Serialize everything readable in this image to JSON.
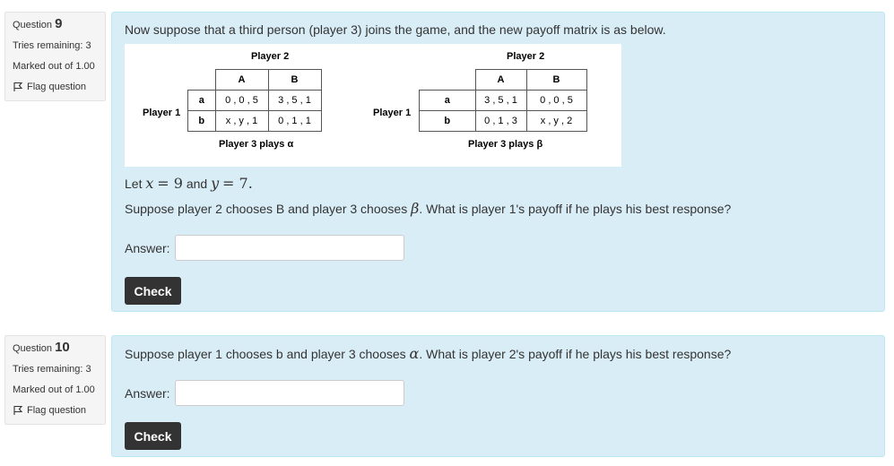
{
  "q9": {
    "info": {
      "question_word": "Question",
      "number": "9",
      "tries": "Tries remaining: 3",
      "marked": "Marked out of 1.00",
      "flag_label": "Flag question"
    },
    "text1": "Now suppose that a third person (player 3) joins the game, and the new payoff matrix is as below.",
    "matrix_alpha": {
      "col_player": "Player 2",
      "row_player": "Player 1",
      "cols": [
        "A",
        "B"
      ],
      "rows": [
        {
          "label": "a",
          "cells": [
            "0 , 0 , 5",
            "3 , 5 , 1"
          ]
        },
        {
          "label": "b",
          "cells": [
            "x , y , 1",
            "0 , 1 , 1"
          ]
        }
      ],
      "caption": "Player 3 plays α"
    },
    "matrix_beta": {
      "col_player": "Player 2",
      "row_player": "Player 1",
      "cols": [
        "A",
        "B"
      ],
      "rows": [
        {
          "label": "a",
          "cells": [
            "3 , 5 , 1",
            "0 , 0 , 5"
          ]
        },
        {
          "label": "b",
          "cells": [
            "0 , 1 , 3",
            "x , y , 2"
          ]
        }
      ],
      "caption": "Player 3 plays β"
    },
    "let_prefix": "Let",
    "let_x": "x",
    "let_eq1": "= 9",
    "let_and": "and",
    "let_y": "y",
    "let_eq2": "= 7.",
    "text3_a": "Suppose player 2 chooses B and player 3 chooses",
    "text3_sym": "β",
    "text3_b": ". What is player 1's payoff if he plays his best response?",
    "answer_label": "Answer:",
    "answer_value": "",
    "check_label": "Check"
  },
  "q10": {
    "info": {
      "question_word": "Question",
      "number": "10",
      "tries": "Tries remaining: 3",
      "marked": "Marked out of 1.00",
      "flag_label": "Flag question"
    },
    "text_a": "Suppose player 1 chooses b and player 3 chooses",
    "text_sym": "α",
    "text_b": ". What is player 2's payoff if he plays his best response?",
    "answer_label": "Answer:",
    "answer_value": "",
    "check_label": "Check"
  }
}
